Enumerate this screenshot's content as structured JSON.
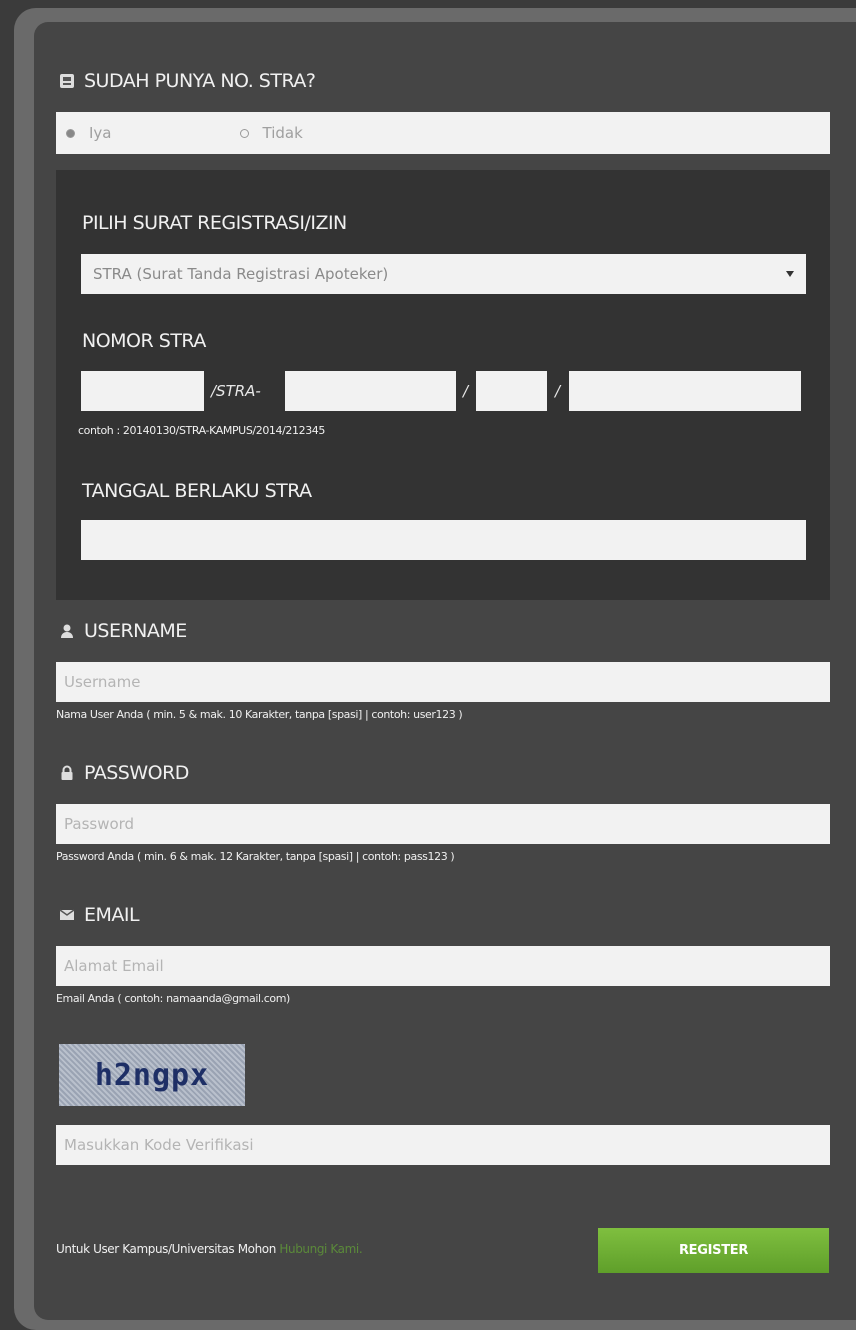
{
  "stra_question": {
    "title": "SUDAH PUNYA NO. STRA?",
    "options": [
      {
        "label": "Iya",
        "selected": true
      },
      {
        "label": "Tidak",
        "selected": false
      }
    ]
  },
  "stra_panel": {
    "select_title": "PILIH SURAT REGISTRASI/IZIN",
    "select_value": "STRA (Surat Tanda Registrasi Apoteker)",
    "nomor_title": "NOMOR STRA",
    "sep_stra": "/STRA-",
    "sep_slash": "/",
    "example": "contoh : 20140130/STRA-KAMPUS/2014/212345",
    "tanggal_title": "TANGGAL BERLAKU STRA"
  },
  "username": {
    "title": "USERNAME",
    "placeholder": "Username",
    "help": "Nama User Anda ( min. 5 & mak. 10 Karakter, tanpa [spasi] | contoh: user123 )"
  },
  "password": {
    "title": "PASSWORD",
    "placeholder": "Password",
    "help": "Password Anda ( min. 6 & mak. 12 Karakter, tanpa [spasi] | contoh: pass123 )"
  },
  "email": {
    "title": "EMAIL",
    "placeholder": "Alamat Email",
    "help": "Email Anda ( contoh: namaanda@gmail.com)"
  },
  "captcha": {
    "code": "h2ngpx",
    "placeholder": "Masukkan Kode Verifikasi"
  },
  "footer": {
    "text": "Untuk User Kampus/Universitas Mohon",
    "link": "Hubungi Kami."
  },
  "register_label": "REGISTER",
  "colors": {
    "accent": "#6aaf33",
    "link": "#5b8a3a"
  }
}
